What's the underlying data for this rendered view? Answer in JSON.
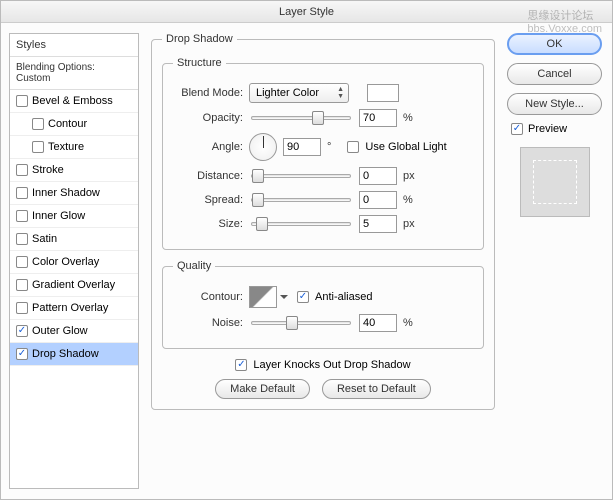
{
  "window": {
    "title": "Layer Style"
  },
  "sidebar": {
    "styles_header": "Styles",
    "blending_label": "Blending Options: Custom",
    "items": [
      {
        "label": "Bevel & Emboss",
        "checked": false,
        "sub": false,
        "selected": false
      },
      {
        "label": "Contour",
        "checked": false,
        "sub": true,
        "selected": false
      },
      {
        "label": "Texture",
        "checked": false,
        "sub": true,
        "selected": false
      },
      {
        "label": "Stroke",
        "checked": false,
        "sub": false,
        "selected": false
      },
      {
        "label": "Inner Shadow",
        "checked": false,
        "sub": false,
        "selected": false
      },
      {
        "label": "Inner Glow",
        "checked": false,
        "sub": false,
        "selected": false
      },
      {
        "label": "Satin",
        "checked": false,
        "sub": false,
        "selected": false
      },
      {
        "label": "Color Overlay",
        "checked": false,
        "sub": false,
        "selected": false
      },
      {
        "label": "Gradient Overlay",
        "checked": false,
        "sub": false,
        "selected": false
      },
      {
        "label": "Pattern Overlay",
        "checked": false,
        "sub": false,
        "selected": false
      },
      {
        "label": "Outer Glow",
        "checked": true,
        "sub": false,
        "selected": false
      },
      {
        "label": "Drop Shadow",
        "checked": true,
        "sub": false,
        "selected": true
      }
    ]
  },
  "panel": {
    "title": "Drop Shadow",
    "structure": {
      "legend": "Structure",
      "blend_mode_label": "Blend Mode:",
      "blend_mode_value": "Lighter Color",
      "blend_color": "#ffffff",
      "opacity_label": "Opacity:",
      "opacity_value": "70",
      "opacity_unit": "%",
      "angle_label": "Angle:",
      "angle_value": "90",
      "use_global_label": "Use Global Light",
      "use_global_checked": false,
      "distance_label": "Distance:",
      "distance_value": "0",
      "distance_unit": "px",
      "spread_label": "Spread:",
      "spread_value": "0",
      "spread_unit": "%",
      "size_label": "Size:",
      "size_value": "5",
      "size_unit": "px"
    },
    "quality": {
      "legend": "Quality",
      "contour_label": "Contour:",
      "antialiased_label": "Anti-aliased",
      "antialiased_checked": true,
      "noise_label": "Noise:",
      "noise_value": "40",
      "noise_unit": "%"
    },
    "knockout_label": "Layer Knocks Out Drop Shadow",
    "knockout_checked": true,
    "make_default": "Make Default",
    "reset_default": "Reset to Default"
  },
  "right": {
    "ok": "OK",
    "cancel": "Cancel",
    "new_style": "New Style...",
    "preview_label": "Preview",
    "preview_checked": true
  },
  "watermark": {
    "line1": "思缘设计论坛",
    "line2": "bbs.Voxxe.com"
  }
}
